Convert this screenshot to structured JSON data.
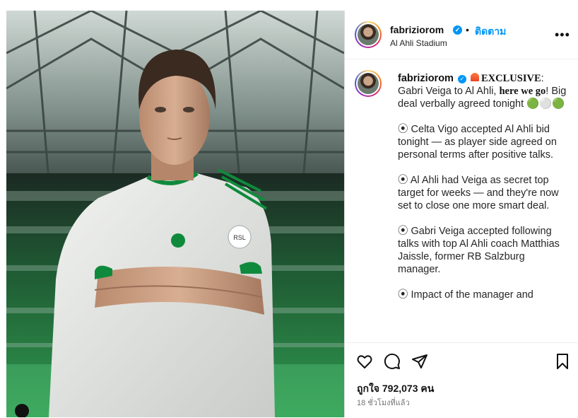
{
  "post": {
    "username": "fabriziorom",
    "verified_mark": "✓",
    "separator": "•",
    "follow_label": "ติดตาม",
    "location": "Al Ahli Stadium",
    "more_label": "•••"
  },
  "caption": {
    "username": "fabriziorom",
    "line1_bold": "EXCLUSIVE",
    "line1_rest": ": Gabri Veiga to Al Ahli, ",
    "here_we_go": "here we go",
    "line1_end": "! Big deal verbally agreed tonight 🟢⚪️🟢",
    "p2": "⦿ Celta Vigo accepted Al Ahli bid tonight — as player side agreed on personal terms after positive talks.",
    "p3": "⦿ Al Ahli had Veiga as secret top target for weeks — and they're now set to close one more smart deal.",
    "p4": "⦿ Gabri Veiga accepted following talks with top Al Ahli coach Matthias Jaissle, former RB Salzburg manager.",
    "p5": "⦿ Impact of the manager and"
  },
  "actions": {
    "icons": [
      "heart-icon",
      "comment-icon",
      "share-icon",
      "bookmark-icon"
    ],
    "likes": "ถูกใจ 792,073 คน",
    "time": "18 ชั่วโมงที่แล้ว"
  },
  "media": {
    "jersey_text": "RSL"
  },
  "colors": {
    "accent": "#0095f6",
    "jersey": "#e9ebe8",
    "jersey_trim": "#0f8a3c",
    "stands_green": "#1f7a3a"
  }
}
